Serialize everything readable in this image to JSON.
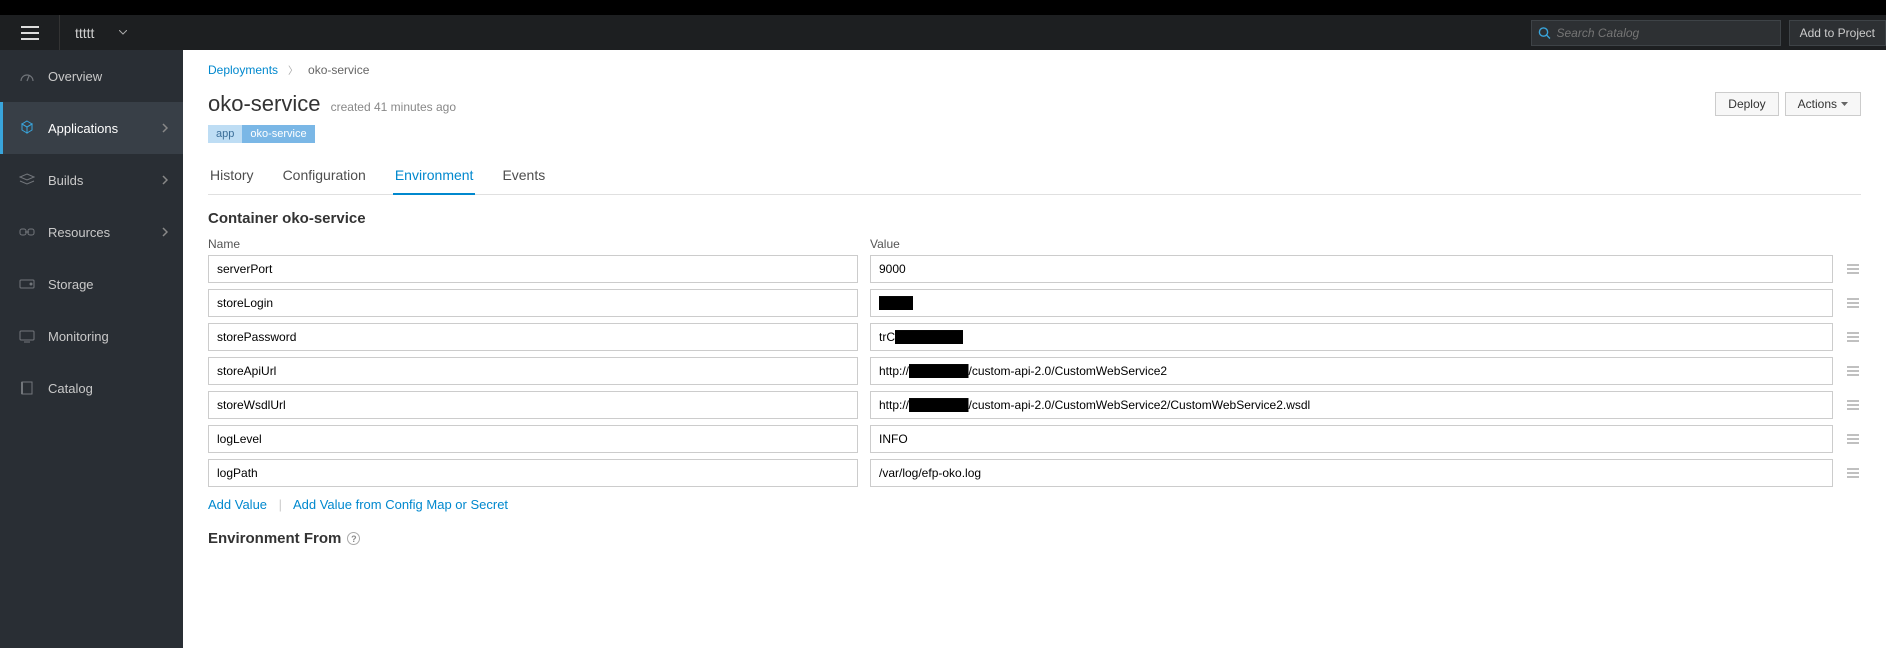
{
  "header": {
    "project_name": "ttttt",
    "search_placeholder": "Search Catalog",
    "add_project_label": "Add to Project"
  },
  "sidebar": {
    "items": [
      {
        "label": "Overview",
        "icon": "dashboard",
        "active": false,
        "expandable": false
      },
      {
        "label": "Applications",
        "icon": "cubes",
        "active": true,
        "expandable": true
      },
      {
        "label": "Builds",
        "icon": "layers",
        "active": false,
        "expandable": true
      },
      {
        "label": "Resources",
        "icon": "chain",
        "active": false,
        "expandable": true
      },
      {
        "label": "Storage",
        "icon": "hdd",
        "active": false,
        "expandable": false
      },
      {
        "label": "Monitoring",
        "icon": "monitor",
        "active": false,
        "expandable": false
      },
      {
        "label": "Catalog",
        "icon": "book",
        "active": false,
        "expandable": false
      }
    ]
  },
  "breadcrumb": {
    "parent": "Deployments",
    "current": "oko-service"
  },
  "page": {
    "title": "oko-service",
    "created_text": "created 41 minutes ago",
    "labels": {
      "key": "app",
      "value": "oko-service"
    },
    "buttons": {
      "deploy": "Deploy",
      "actions": "Actions"
    }
  },
  "tabs": [
    {
      "label": "History",
      "active": false
    },
    {
      "label": "Configuration",
      "active": false
    },
    {
      "label": "Environment",
      "active": true
    },
    {
      "label": "Events",
      "active": false
    }
  ],
  "env": {
    "container_title": "Container oko-service",
    "col_name": "Name",
    "col_value": "Value",
    "rows": [
      {
        "name": "serverPort",
        "value": "9000"
      },
      {
        "name": "storeLogin",
        "value": "████"
      },
      {
        "name": "storePassword",
        "value": "trC████████"
      },
      {
        "name": "storeApiUrl",
        "value": "http://███████/custom-api-2.0/CustomWebService2"
      },
      {
        "name": "storeWsdlUrl",
        "value": "http://███████/custom-api-2.0/CustomWebService2/CustomWebService2.wsdl"
      },
      {
        "name": "logLevel",
        "value": "INFO"
      },
      {
        "name": "logPath",
        "value": "/var/log/efp-oko.log"
      }
    ],
    "add_value": "Add Value",
    "add_from_cm": "Add Value from Config Map or Secret",
    "env_from_title": "Environment From"
  }
}
